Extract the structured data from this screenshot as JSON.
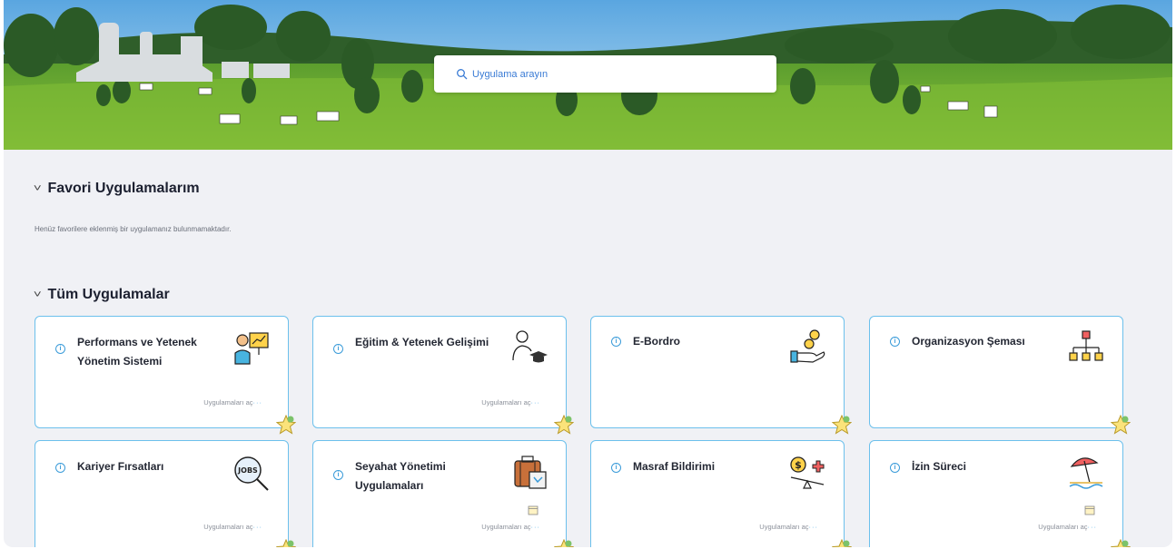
{
  "search": {
    "placeholder": "Uygulama arayın"
  },
  "favorites": {
    "title": "Favori Uygulamalarım",
    "empty_message": "Henüz favorilere eklenmiş bir uygulamanız bulunmamaktadır."
  },
  "all_apps": {
    "title": "Tüm Uygulamalar",
    "open_label": "Uygulamaları aç",
    "cards": [
      {
        "title": "Performans ve Yetenek Yönetim Sistemi",
        "icon": "presentation-icon"
      },
      {
        "title": "Eğitim & Yetenek Gelişimi",
        "icon": "graduate-icon"
      },
      {
        "title": "E-Bordro",
        "icon": "payroll-hand-icon"
      },
      {
        "title": "Organizasyon Şeması",
        "icon": "org-chart-icon"
      },
      {
        "title": "Kariyer Fırsatları",
        "icon": "jobs-magnifier-icon"
      },
      {
        "title": "Seyahat Yönetimi Uygulamaları",
        "icon": "luggage-icon"
      },
      {
        "title": "Masraf Bildirimi",
        "icon": "expense-scale-icon"
      },
      {
        "title": "İzin Süreci",
        "icon": "beach-umbrella-icon"
      }
    ]
  },
  "colors": {
    "accent": "#3a9bd9",
    "card_border": "#6cc0ec",
    "background": "#f0f1f5"
  }
}
